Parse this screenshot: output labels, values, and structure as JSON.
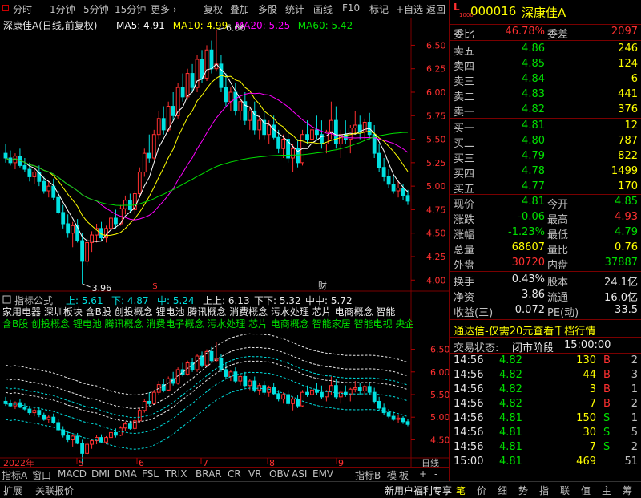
{
  "toolbar": {
    "left_items": [
      "分时",
      "1分钟",
      "5分钟",
      "15分钟",
      "更多 ›"
    ],
    "right_items": [
      "复权",
      "叠加",
      "多股",
      "统计",
      "画线",
      "F10",
      "标记",
      "+自选",
      "返回"
    ]
  },
  "quote_header": {
    "badge_top": "L",
    "badge_bottom": "1000",
    "code": "000016",
    "name": "深康佳A"
  },
  "main_chart": {
    "legend": [
      {
        "label": "深康佳A(日线,前复权)",
        "color": "#e8e8e8"
      },
      {
        "label": "MA5: 4.91",
        "color": "#ffffff"
      },
      {
        "label": "MA10: 4.99",
        "color": "#ffff00"
      },
      {
        "label": "MA20: 5.25",
        "color": "#ff00ff"
      },
      {
        "label": "MA60: 5.42",
        "color": "#00e000"
      }
    ],
    "price_ticks": [
      "6.50",
      "6.25",
      "6.00",
      "5.75",
      "5.50",
      "5.25",
      "5.00",
      "4.75",
      "4.50",
      "4.25",
      "4.00"
    ],
    "high_label": "6.66",
    "low_label": "3.96",
    "markers": [
      "$",
      "财"
    ]
  },
  "indicator_chart": {
    "legend": [
      {
        "label": "指标公式",
        "color": "#c0c0c0"
      },
      {
        "label": "上: 5.61",
        "color": "#00e0e0"
      },
      {
        "label": "下: 4.87",
        "color": "#00e0e0"
      },
      {
        "label": "中: 5.24",
        "color": "#00e0e0"
      },
      {
        "label": "上上: 6.13",
        "color": "#e8e8e8"
      },
      {
        "label": "下下: 5.32",
        "color": "#e8e8e8"
      },
      {
        "label": "中中: 5.72",
        "color": "#e8e8e8"
      }
    ],
    "concept_line_1": "家用电器 深圳板块 含B股 创投概念 锂电池 腾讯概念 消费概念 污水处理 芯片 电商概念 智能",
    "concept_line_2": "含B股 创投概念 锂电池 腾讯概念 消费电子概念 污水处理 芯片 电商概念 智能家居 智能电视 央企改",
    "price_ticks": [
      "6.50",
      "6.00",
      "5.50",
      "5.00",
      "4.50"
    ]
  },
  "date_axis": {
    "labels": [
      "2022年",
      "5",
      "6",
      "7",
      "8",
      "9"
    ],
    "right_label": "日线"
  },
  "bottom_tabs": [
    "指标A",
    "窗口",
    "MACD",
    "DMI",
    "DMA",
    "FSL",
    "TRIX",
    "BRAR",
    "CR",
    "VR",
    "OBV",
    "ASI",
    "EMV",
    "指标B",
    "模",
    "板",
    "+",
    "-"
  ],
  "bottom_bar": {
    "left": [
      "扩展",
      "关联报价"
    ],
    "promo": "新用户福利专享",
    "right": [
      "笔",
      "价",
      "细",
      "势",
      "指",
      "联",
      "值",
      "主",
      "筹"
    ]
  },
  "order_book": {
    "committee_ratio_label": "委比",
    "committee_ratio": "46.78%",
    "committee_diff_label": "委差",
    "committee_diff": "2097",
    "asks": [
      {
        "label": "卖五",
        "price": "4.86",
        "volume": "246"
      },
      {
        "label": "卖四",
        "price": "4.85",
        "volume": "124"
      },
      {
        "label": "卖三",
        "price": "4.84",
        "volume": "6"
      },
      {
        "label": "卖二",
        "price": "4.83",
        "volume": "441"
      },
      {
        "label": "卖一",
        "price": "4.82",
        "volume": "376"
      }
    ],
    "bids": [
      {
        "label": "买一",
        "price": "4.81",
        "volume": "12"
      },
      {
        "label": "买二",
        "price": "4.80",
        "volume": "787"
      },
      {
        "label": "买三",
        "price": "4.79",
        "volume": "822"
      },
      {
        "label": "买四",
        "price": "4.78",
        "volume": "1499"
      },
      {
        "label": "买五",
        "price": "4.77",
        "volume": "170"
      }
    ]
  },
  "stats": [
    {
      "l1": "现价",
      "v1": "4.81",
      "c1": "green",
      "l2": "今开",
      "v2": "4.85",
      "c2": "green"
    },
    {
      "l1": "涨跌",
      "v1": "-0.06",
      "c1": "green",
      "l2": "最高",
      "v2": "4.93",
      "c2": "red"
    },
    {
      "l1": "涨幅",
      "v1": "-1.23%",
      "c1": "green",
      "l2": "最低",
      "v2": "4.79",
      "c2": "green"
    },
    {
      "l1": "总量",
      "v1": "68607",
      "c1": "yellow",
      "l2": "量比",
      "v2": "0.76",
      "c2": "yellow"
    },
    {
      "l1": "外盘",
      "v1": "30720",
      "c1": "red",
      "l2": "内盘",
      "v2": "37887",
      "c2": "green"
    }
  ],
  "stats2": [
    {
      "l1": "换手",
      "v1": "0.43%",
      "l2": "股本",
      "v2": "24.1亿"
    },
    {
      "l1": "净资",
      "v1": "3.86",
      "l2": "流通",
      "v2": "16.0亿"
    },
    {
      "l1": "收益(三)",
      "v1": "0.072",
      "l2": "PE(动)",
      "v2": "33.5"
    }
  ],
  "promo_line": "通达信-仅需20元查看千档行情",
  "trade_status": {
    "label": "交易状态:",
    "value": "闭市阶段",
    "time": "15:00:00"
  },
  "ticks": [
    {
      "time": "14:56",
      "price": "4.82",
      "vol": "130",
      "side": "B",
      "n": "2"
    },
    {
      "time": "14:56",
      "price": "4.82",
      "vol": "44",
      "side": "B",
      "n": "3"
    },
    {
      "time": "14:56",
      "price": "4.82",
      "vol": "3",
      "side": "B",
      "n": "1"
    },
    {
      "time": "14:56",
      "price": "4.82",
      "vol": "7",
      "side": "B",
      "n": "2"
    },
    {
      "time": "14:56",
      "price": "4.81",
      "vol": "150",
      "side": "S",
      "n": "1"
    },
    {
      "time": "14:56",
      "price": "4.81",
      "vol": "30",
      "side": "S",
      "n": "5"
    },
    {
      "time": "14:56",
      "price": "4.81",
      "vol": "7",
      "side": "S",
      "n": "2"
    },
    {
      "time": "15:00",
      "price": "4.81",
      "vol": "469",
      "side": "",
      "n": "51"
    }
  ],
  "chart_data": {
    "type": "candlestick",
    "title": "深康佳A(日线,前复权)",
    "ylim": [
      3.9,
      6.7
    ],
    "x_labels": [
      "2022年",
      "5",
      "6",
      "7",
      "8",
      "9"
    ],
    "ohlc": [
      [
        5.35,
        5.45,
        5.25,
        5.3
      ],
      [
        5.3,
        5.38,
        5.22,
        5.25
      ],
      [
        5.25,
        5.35,
        5.18,
        5.32
      ],
      [
        5.32,
        5.4,
        5.2,
        5.22
      ],
      [
        5.22,
        5.3,
        5.15,
        5.18
      ],
      [
        5.18,
        5.25,
        5.05,
        5.1
      ],
      [
        5.1,
        5.2,
        5.02,
        5.15
      ],
      [
        5.15,
        5.22,
        5.0,
        5.05
      ],
      [
        5.05,
        5.1,
        4.92,
        4.95
      ],
      [
        4.95,
        5.05,
        4.88,
        5.0
      ],
      [
        5.0,
        5.08,
        4.85,
        4.88
      ],
      [
        4.88,
        4.95,
        4.7,
        4.72
      ],
      [
        4.72,
        4.8,
        4.55,
        4.6
      ],
      [
        4.6,
        4.7,
        4.45,
        4.5
      ],
      [
        4.5,
        4.62,
        4.35,
        4.58
      ],
      [
        4.58,
        4.65,
        4.4,
        4.42
      ],
      [
        4.42,
        4.5,
        3.96,
        4.2
      ],
      [
        4.2,
        4.45,
        4.15,
        4.4
      ],
      [
        4.4,
        4.52,
        4.3,
        4.48
      ],
      [
        4.48,
        4.6,
        4.4,
        4.55
      ],
      [
        4.55,
        4.62,
        4.42,
        4.45
      ],
      [
        4.45,
        4.58,
        4.4,
        4.55
      ],
      [
        4.55,
        4.7,
        4.5,
        4.66
      ],
      [
        4.66,
        4.75,
        4.55,
        4.6
      ],
      [
        4.6,
        4.8,
        4.58,
        4.76
      ],
      [
        4.76,
        4.9,
        4.7,
        4.85
      ],
      [
        4.85,
        4.92,
        4.72,
        4.75
      ],
      [
        4.75,
        4.95,
        4.7,
        4.92
      ],
      [
        4.92,
        5.2,
        4.88,
        5.15
      ],
      [
        5.15,
        5.4,
        5.1,
        5.35
      ],
      [
        5.35,
        5.55,
        5.25,
        5.3
      ],
      [
        5.3,
        5.6,
        5.28,
        5.55
      ],
      [
        5.55,
        5.8,
        5.5,
        5.72
      ],
      [
        5.72,
        5.85,
        5.55,
        5.6
      ],
      [
        5.6,
        5.9,
        5.58,
        5.85
      ],
      [
        5.85,
        6.0,
        5.7,
        5.75
      ],
      [
        5.75,
        6.1,
        5.72,
        6.05
      ],
      [
        6.05,
        6.2,
        5.9,
        5.95
      ],
      [
        5.95,
        6.25,
        5.92,
        6.2
      ],
      [
        6.2,
        6.3,
        6.0,
        6.05
      ],
      [
        6.05,
        6.4,
        6.0,
        6.35
      ],
      [
        6.35,
        6.45,
        6.1,
        6.15
      ],
      [
        6.15,
        6.5,
        6.12,
        6.45
      ],
      [
        6.45,
        6.55,
        6.2,
        6.25
      ],
      [
        6.25,
        6.66,
        6.22,
        6.3
      ],
      [
        6.3,
        6.4,
        6.0,
        6.05
      ],
      [
        6.05,
        6.2,
        5.85,
        5.9
      ],
      [
        5.9,
        6.05,
        5.8,
        6.0
      ],
      [
        6.0,
        6.1,
        5.75,
        5.8
      ],
      [
        5.8,
        5.95,
        5.7,
        5.9
      ],
      [
        5.9,
        6.0,
        5.65,
        5.7
      ],
      [
        5.7,
        5.85,
        5.6,
        5.8
      ],
      [
        5.8,
        5.9,
        5.55,
        5.6
      ],
      [
        5.6,
        5.75,
        5.5,
        5.7
      ],
      [
        5.7,
        5.8,
        5.5,
        5.55
      ],
      [
        5.55,
        5.7,
        5.45,
        5.65
      ],
      [
        5.65,
        5.75,
        5.5,
        5.52
      ],
      [
        5.52,
        5.6,
        5.35,
        5.4
      ],
      [
        5.4,
        5.55,
        5.3,
        5.5
      ],
      [
        5.5,
        5.6,
        5.25,
        5.3
      ],
      [
        5.3,
        5.45,
        5.15,
        5.4
      ],
      [
        5.4,
        5.5,
        5.2,
        5.25
      ],
      [
        5.25,
        5.6,
        5.22,
        5.55
      ],
      [
        5.55,
        5.7,
        5.45,
        5.5
      ],
      [
        5.5,
        5.65,
        5.4,
        5.6
      ],
      [
        5.6,
        5.75,
        5.5,
        5.55
      ],
      [
        5.55,
        5.7,
        5.4,
        5.45
      ],
      [
        5.45,
        5.6,
        5.35,
        5.58
      ],
      [
        5.58,
        5.9,
        5.5,
        5.7
      ],
      [
        5.7,
        5.85,
        5.4,
        5.45
      ],
      [
        5.45,
        5.6,
        5.3,
        5.55
      ],
      [
        5.55,
        5.7,
        5.45,
        5.5
      ],
      [
        5.5,
        5.65,
        5.35,
        5.62
      ],
      [
        5.62,
        5.8,
        5.55,
        5.65
      ],
      [
        5.65,
        5.75,
        5.5,
        5.58
      ],
      [
        5.58,
        5.72,
        5.48,
        5.68
      ],
      [
        5.68,
        5.78,
        5.5,
        5.55
      ],
      [
        5.55,
        5.65,
        5.3,
        5.35
      ],
      [
        5.35,
        5.45,
        5.15,
        5.2
      ],
      [
        5.2,
        5.3,
        5.05,
        5.1
      ],
      [
        5.1,
        5.18,
        4.98,
        5.02
      ],
      [
        5.02,
        5.12,
        4.92,
        4.95
      ],
      [
        4.95,
        5.05,
        4.88,
        4.98
      ],
      [
        4.98,
        5.02,
        4.85,
        4.9
      ],
      [
        4.9,
        4.96,
        4.8,
        4.84
      ]
    ],
    "series": [
      {
        "name": "MA5",
        "color": "#ffffff"
      },
      {
        "name": "MA10",
        "color": "#ffff00"
      },
      {
        "name": "MA20",
        "color": "#ff00ff"
      },
      {
        "name": "MA60",
        "color": "#00e000"
      }
    ]
  }
}
